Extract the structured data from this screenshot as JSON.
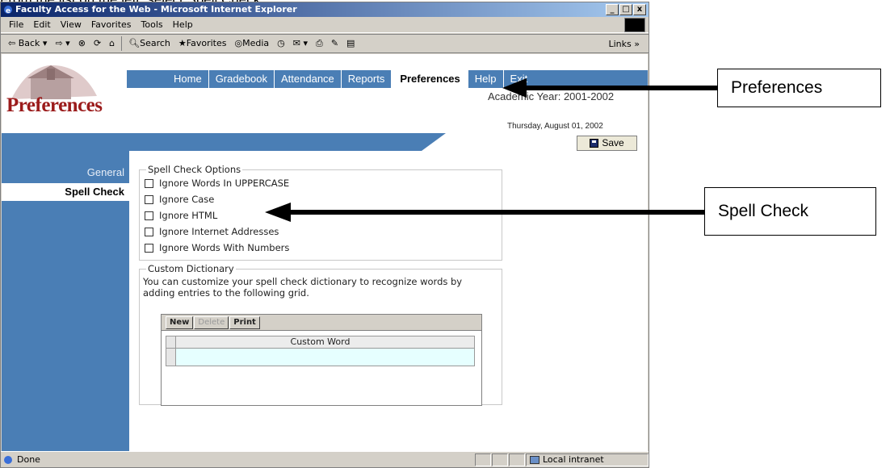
{
  "caption": "From the list on the left, select Spell Check.",
  "window": {
    "title": "Faculty Access for the Web - Microsoft Internet Explorer",
    "controls": [
      "_",
      "□",
      "x"
    ]
  },
  "menu": [
    "File",
    "Edit",
    "View",
    "Favorites",
    "Tools",
    "Help"
  ],
  "toolbar": {
    "back": "Back",
    "search": "Search",
    "favorites": "Favorites",
    "media": "Media",
    "links": "Links"
  },
  "app": {
    "logo_text": "Preferences",
    "nav": [
      "Home",
      "Gradebook",
      "Attendance",
      "Reports",
      "Preferences",
      "Help",
      "Exit"
    ],
    "active_nav": "Preferences",
    "academic_year": "Academic Year: 2001-2002",
    "date": "Thursday, August 01, 2002",
    "save_label": "Save",
    "sidebar": [
      "General",
      "Spell Check"
    ],
    "spell_check_legend": "Spell Check Options",
    "spell_check_options": [
      "Ignore Words In UPPERCASE",
      "Ignore Case",
      "Ignore HTML",
      "Ignore Internet Addresses",
      "Ignore Words With Numbers"
    ],
    "dictionary_legend": "Custom Dictionary",
    "dictionary_desc": "You can customize your spell check dictionary to recognize words by adding entries to the following grid.",
    "grid_buttons": {
      "new": "New",
      "delete": "Delete",
      "print": "Print"
    },
    "grid_column": "Custom Word"
  },
  "status": {
    "text": "Done",
    "zone": "Local intranet"
  },
  "callouts": {
    "preferences": "Preferences",
    "spell_check": "Spell Check"
  }
}
